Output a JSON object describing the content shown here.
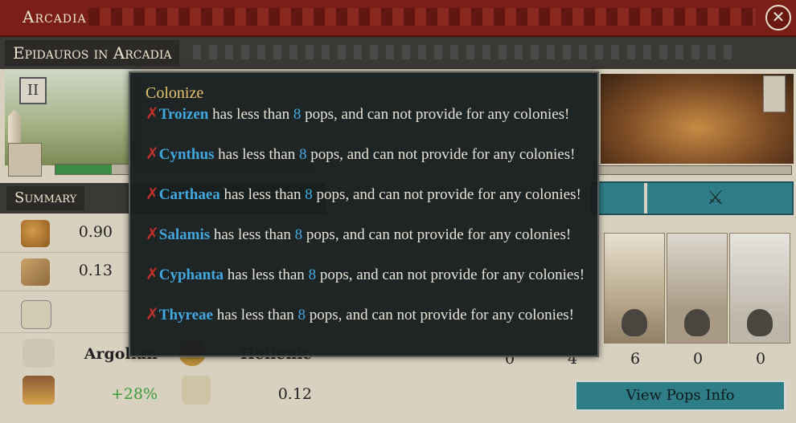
{
  "window": {
    "title": "Arcadia",
    "subtitle": "Epidauros in Arcadia",
    "close_icon": "close-icon"
  },
  "city": {
    "rank": "II",
    "growth_progress_pct": 22
  },
  "summary": {
    "title": "Summary",
    "food_value": "0.90",
    "commerce_value": "0.13",
    "culture": "Argolian",
    "religion": "Hellenic",
    "goods_modifier": "+28%",
    "scroll_value": "0.12"
  },
  "pops": {
    "counts": [
      "0",
      "4",
      "6",
      "0",
      "0"
    ],
    "view_button_label": "View Pops Info"
  },
  "tooltip": {
    "title": "Colonize",
    "middle_text": "has less than",
    "tail_text": "pops, and can not provide for any colonies!",
    "items": [
      {
        "name": "Troizen",
        "pops": "8"
      },
      {
        "name": "Cynthus",
        "pops": "8"
      },
      {
        "name": "Carthaea",
        "pops": "8"
      },
      {
        "name": "Salamis",
        "pops": "8"
      },
      {
        "name": "Cyphanta",
        "pops": "8"
      },
      {
        "name": "Thyreae",
        "pops": "8"
      }
    ]
  },
  "colors": {
    "title_bar": "#7a1e18",
    "tooltip_bg": "#191e1f",
    "tooltip_title": "#e6c36c",
    "highlight_blue": "#41a8df",
    "fail_red": "#c0302b",
    "positive_green": "#3b9a3b",
    "teal": "#2f7d86"
  }
}
